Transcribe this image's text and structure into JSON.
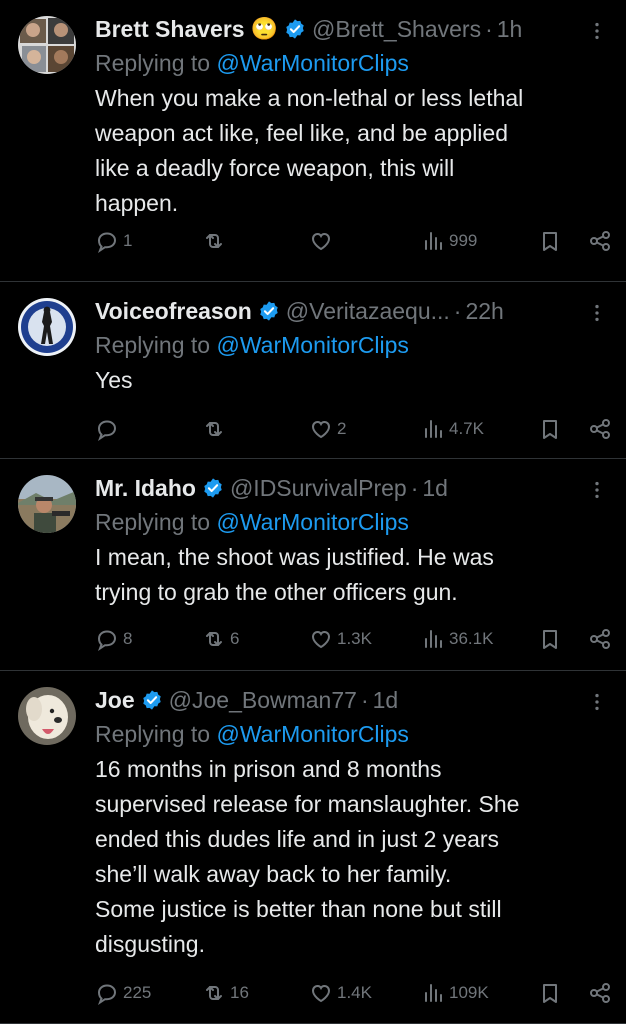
{
  "colors": {
    "background": "#000000",
    "text": "#e7e9ea",
    "muted": "#71767b",
    "link": "#1d9bf0",
    "verified": "#1d9bf0"
  },
  "tweets": [
    {
      "name": "Brett Shavers",
      "emoji": "🙄",
      "handle": "@Brett_Shavers",
      "time": "1h",
      "replying_prefix": "Replying to ",
      "replying_to": "@WarMonitorClips",
      "text": "When you make a non-lethal or less lethal\nweapon act like, feel like, and be applied\nlike a deadly force weapon, this will\nhappen.",
      "replies": "1",
      "retweets": "",
      "likes": "",
      "views": "999"
    },
    {
      "name": "Voiceofreason",
      "handle": "@Veritazaequ...",
      "time": "22h",
      "replying_prefix": "Replying to ",
      "replying_to": "@WarMonitorClips",
      "text": "Yes",
      "replies": "",
      "retweets": "",
      "likes": "2",
      "views": "4.7K"
    },
    {
      "name": "Mr. Idaho",
      "handle": "@IDSurvivalPrep",
      "time": "1d",
      "replying_prefix": "Replying to ",
      "replying_to": "@WarMonitorClips",
      "text": "I mean, the shoot was justified. He was\ntrying to grab the other officers gun.",
      "replies": "8",
      "retweets": "6",
      "likes": "1.3K",
      "views": "36.1K"
    },
    {
      "name": "Joe",
      "handle": "@Joe_Bowman77",
      "time": "1d",
      "replying_prefix": "Replying to ",
      "replying_to": "@WarMonitorClips",
      "text": "16 months in prison and 8 months\nsupervised release for manslaughter. She\nended this dudes life and in just 2 years\nshe’ll walk away back to her family.\nSome justice is better than none but still\ndisgusting.",
      "replies": "225",
      "retweets": "16",
      "likes": "1.4K",
      "views": "109K"
    }
  ],
  "icons": [
    "reply-icon",
    "retweet-icon",
    "like-icon",
    "views-icon",
    "bookmark-icon",
    "share-icon",
    "more-icon",
    "verified-badge-icon"
  ]
}
